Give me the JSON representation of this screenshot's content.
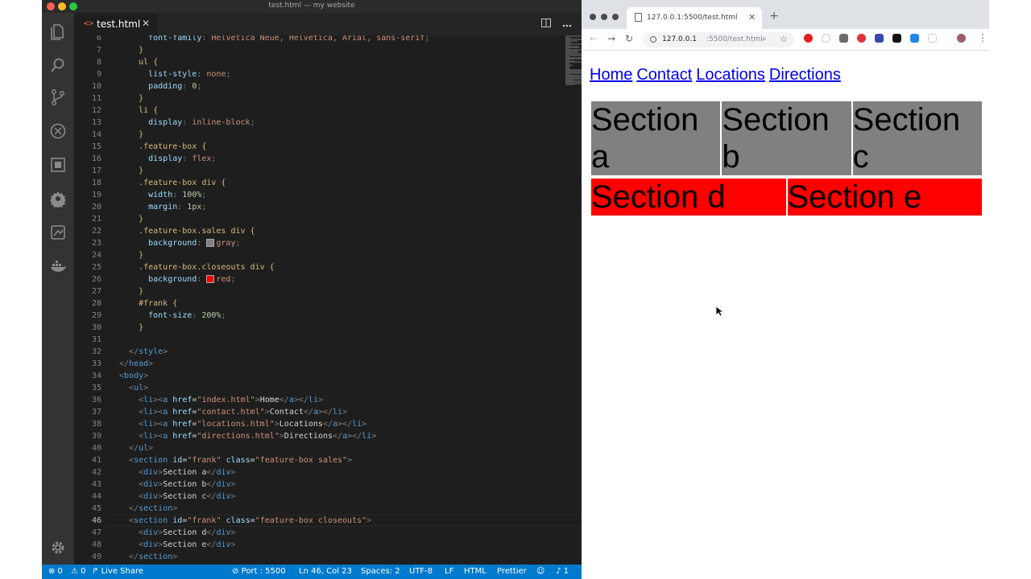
{
  "vscode": {
    "window_title": "test.html — my website",
    "tab": {
      "name": "test.html",
      "icon": "<>",
      "close": "✕"
    },
    "lines": [
      {
        "n": "6",
        "parts": [
          [
            "      ",
            "t"
          ],
          [
            "font-family",
            "prop"
          ],
          [
            ": ",
            "pun"
          ],
          [
            "Helvetica Neue, Helvetica, Arial, sans-serif",
            "val"
          ],
          [
            ";",
            "pun"
          ]
        ]
      },
      {
        "n": "7",
        "parts": [
          [
            "    }",
            "sel"
          ]
        ]
      },
      {
        "n": "8",
        "parts": [
          [
            "    ul {",
            "sel"
          ]
        ]
      },
      {
        "n": "9",
        "parts": [
          [
            "      ",
            "t"
          ],
          [
            "list-style",
            "prop"
          ],
          [
            ": ",
            "pun"
          ],
          [
            "none",
            "val"
          ],
          [
            ";",
            "pun"
          ]
        ]
      },
      {
        "n": "10",
        "parts": [
          [
            "      ",
            "t"
          ],
          [
            "padding",
            "prop"
          ],
          [
            ": ",
            "pun"
          ],
          [
            "0",
            "num"
          ],
          [
            ";",
            "pun"
          ]
        ]
      },
      {
        "n": "11",
        "parts": [
          [
            "    }",
            "sel"
          ]
        ]
      },
      {
        "n": "12",
        "parts": [
          [
            "    li {",
            "sel"
          ]
        ]
      },
      {
        "n": "13",
        "parts": [
          [
            "      ",
            "t"
          ],
          [
            "display",
            "prop"
          ],
          [
            ": ",
            "pun"
          ],
          [
            "inline-block",
            "val"
          ],
          [
            ";",
            "pun"
          ]
        ]
      },
      {
        "n": "14",
        "parts": [
          [
            "    }",
            "sel"
          ]
        ]
      },
      {
        "n": "15",
        "parts": [
          [
            "    .feature-box {",
            "sel"
          ]
        ]
      },
      {
        "n": "16",
        "parts": [
          [
            "      ",
            "t"
          ],
          [
            "display",
            "prop"
          ],
          [
            ": ",
            "pun"
          ],
          [
            "flex",
            "val"
          ],
          [
            ";",
            "pun"
          ]
        ]
      },
      {
        "n": "17",
        "parts": [
          [
            "    }",
            "sel"
          ]
        ]
      },
      {
        "n": "18",
        "parts": [
          [
            "    .feature-box div {",
            "sel"
          ]
        ]
      },
      {
        "n": "19",
        "parts": [
          [
            "      ",
            "t"
          ],
          [
            "width",
            "prop"
          ],
          [
            ": ",
            "pun"
          ],
          [
            "100%",
            "num"
          ],
          [
            ";",
            "pun"
          ]
        ]
      },
      {
        "n": "20",
        "parts": [
          [
            "      ",
            "t"
          ],
          [
            "margin",
            "prop"
          ],
          [
            ": ",
            "pun"
          ],
          [
            "1px",
            "num"
          ],
          [
            ";",
            "pun"
          ]
        ]
      },
      {
        "n": "21",
        "parts": [
          [
            "    }",
            "sel"
          ]
        ]
      },
      {
        "n": "22",
        "parts": [
          [
            "    .feature-box.sales div {",
            "sel"
          ]
        ]
      },
      {
        "n": "23",
        "parts": [
          [
            "      ",
            "t"
          ],
          [
            "background",
            "prop"
          ],
          [
            ": ",
            "pun"
          ],
          [
            "#808080",
            "swatch"
          ],
          [
            "gray",
            "val"
          ],
          [
            ";",
            "pun"
          ]
        ]
      },
      {
        "n": "24",
        "parts": [
          [
            "    }",
            "sel"
          ]
        ]
      },
      {
        "n": "25",
        "parts": [
          [
            "    .feature-box.closeouts div {",
            "sel"
          ]
        ]
      },
      {
        "n": "26",
        "parts": [
          [
            "      ",
            "t"
          ],
          [
            "background",
            "prop"
          ],
          [
            ": ",
            "pun"
          ],
          [
            "#ff0000",
            "swatch"
          ],
          [
            "red",
            "val"
          ],
          [
            ";",
            "pun"
          ]
        ]
      },
      {
        "n": "27",
        "parts": [
          [
            "    }",
            "sel"
          ]
        ]
      },
      {
        "n": "28",
        "parts": [
          [
            "    #frank {",
            "sel"
          ]
        ]
      },
      {
        "n": "29",
        "parts": [
          [
            "      ",
            "t"
          ],
          [
            "font-size",
            "prop"
          ],
          [
            ": ",
            "pun"
          ],
          [
            "200%",
            "num"
          ],
          [
            ";",
            "pun"
          ]
        ]
      },
      {
        "n": "30",
        "parts": [
          [
            "    }",
            "sel"
          ]
        ]
      },
      {
        "n": "31",
        "parts": [
          [
            "",
            "t"
          ]
        ]
      },
      {
        "n": "32",
        "parts": [
          [
            "  ",
            "t"
          ],
          [
            "</",
            "pun"
          ],
          [
            "style",
            "tag"
          ],
          [
            ">",
            "pun"
          ]
        ]
      },
      {
        "n": "33",
        "parts": [
          [
            "",
            "t"
          ],
          [
            "</",
            "pun"
          ],
          [
            "head",
            "tag"
          ],
          [
            ">",
            "pun"
          ]
        ]
      },
      {
        "n": "34",
        "parts": [
          [
            "",
            "t"
          ],
          [
            "<",
            "pun"
          ],
          [
            "body",
            "tag"
          ],
          [
            ">",
            "pun"
          ]
        ]
      },
      {
        "n": "35",
        "parts": [
          [
            "  ",
            "t"
          ],
          [
            "<",
            "pun"
          ],
          [
            "ul",
            "tag"
          ],
          [
            ">",
            "pun"
          ]
        ]
      },
      {
        "n": "36",
        "parts": [
          [
            "    ",
            "t"
          ],
          [
            "<",
            "pun"
          ],
          [
            "li",
            "tag"
          ],
          [
            "><",
            "pun"
          ],
          [
            "a",
            "tag"
          ],
          [
            " ",
            "t"
          ],
          [
            "href",
            "attr"
          ],
          [
            "=",
            "t"
          ],
          [
            "\"index.html\"",
            "str"
          ],
          [
            ">",
            "pun"
          ],
          [
            "Home",
            "t"
          ],
          [
            "</",
            "pun"
          ],
          [
            "a",
            "tag"
          ],
          [
            "></",
            "pun"
          ],
          [
            "li",
            "tag"
          ],
          [
            ">",
            "pun"
          ]
        ]
      },
      {
        "n": "37",
        "parts": [
          [
            "    ",
            "t"
          ],
          [
            "<",
            "pun"
          ],
          [
            "li",
            "tag"
          ],
          [
            "><",
            "pun"
          ],
          [
            "a",
            "tag"
          ],
          [
            " ",
            "t"
          ],
          [
            "href",
            "attr"
          ],
          [
            "=",
            "t"
          ],
          [
            "\"contact.html\"",
            "str"
          ],
          [
            ">",
            "pun"
          ],
          [
            "Contact",
            "t"
          ],
          [
            "</",
            "pun"
          ],
          [
            "a",
            "tag"
          ],
          [
            "></",
            "pun"
          ],
          [
            "li",
            "tag"
          ],
          [
            ">",
            "pun"
          ]
        ]
      },
      {
        "n": "38",
        "parts": [
          [
            "    ",
            "t"
          ],
          [
            "<",
            "pun"
          ],
          [
            "li",
            "tag"
          ],
          [
            "><",
            "pun"
          ],
          [
            "a",
            "tag"
          ],
          [
            " ",
            "t"
          ],
          [
            "href",
            "attr"
          ],
          [
            "=",
            "t"
          ],
          [
            "\"locations.html\"",
            "str"
          ],
          [
            ">",
            "pun"
          ],
          [
            "Locations",
            "t"
          ],
          [
            "</",
            "pun"
          ],
          [
            "a",
            "tag"
          ],
          [
            "></",
            "pun"
          ],
          [
            "li",
            "tag"
          ],
          [
            ">",
            "pun"
          ]
        ]
      },
      {
        "n": "39",
        "parts": [
          [
            "    ",
            "t"
          ],
          [
            "<",
            "pun"
          ],
          [
            "li",
            "tag"
          ],
          [
            "><",
            "pun"
          ],
          [
            "a",
            "tag"
          ],
          [
            " ",
            "t"
          ],
          [
            "href",
            "attr"
          ],
          [
            "=",
            "t"
          ],
          [
            "\"directions.html\"",
            "str"
          ],
          [
            ">",
            "pun"
          ],
          [
            "Directions",
            "t"
          ],
          [
            "</",
            "pun"
          ],
          [
            "a",
            "tag"
          ],
          [
            "></",
            "pun"
          ],
          [
            "li",
            "tag"
          ],
          [
            ">",
            "pun"
          ]
        ]
      },
      {
        "n": "40",
        "parts": [
          [
            "  ",
            "t"
          ],
          [
            "</",
            "pun"
          ],
          [
            "ul",
            "tag"
          ],
          [
            ">",
            "pun"
          ]
        ]
      },
      {
        "n": "41",
        "parts": [
          [
            "  ",
            "t"
          ],
          [
            "<",
            "pun"
          ],
          [
            "section",
            "tag"
          ],
          [
            " ",
            "t"
          ],
          [
            "id",
            "attr"
          ],
          [
            "=",
            "t"
          ],
          [
            "\"frank\"",
            "str"
          ],
          [
            " ",
            "t"
          ],
          [
            "class",
            "attr"
          ],
          [
            "=",
            "t"
          ],
          [
            "\"feature-box sales\"",
            "str"
          ],
          [
            ">",
            "pun"
          ]
        ]
      },
      {
        "n": "42",
        "parts": [
          [
            "    ",
            "t"
          ],
          [
            "<",
            "pun"
          ],
          [
            "div",
            "tag"
          ],
          [
            ">",
            "pun"
          ],
          [
            "Section a",
            "t"
          ],
          [
            "</",
            "pun"
          ],
          [
            "div",
            "tag"
          ],
          [
            ">",
            "pun"
          ]
        ]
      },
      {
        "n": "43",
        "parts": [
          [
            "    ",
            "t"
          ],
          [
            "<",
            "pun"
          ],
          [
            "div",
            "tag"
          ],
          [
            ">",
            "pun"
          ],
          [
            "Section b",
            "t"
          ],
          [
            "</",
            "pun"
          ],
          [
            "div",
            "tag"
          ],
          [
            ">",
            "pun"
          ]
        ]
      },
      {
        "n": "44",
        "parts": [
          [
            "    ",
            "t"
          ],
          [
            "<",
            "pun"
          ],
          [
            "div",
            "tag"
          ],
          [
            ">",
            "pun"
          ],
          [
            "Section c",
            "t"
          ],
          [
            "</",
            "pun"
          ],
          [
            "div",
            "tag"
          ],
          [
            ">",
            "pun"
          ]
        ]
      },
      {
        "n": "45",
        "parts": [
          [
            "  ",
            "t"
          ],
          [
            "</",
            "pun"
          ],
          [
            "section",
            "tag"
          ],
          [
            ">",
            "pun"
          ]
        ]
      },
      {
        "n": "46",
        "current": true,
        "parts": [
          [
            "  ",
            "t"
          ],
          [
            "<",
            "pun"
          ],
          [
            "section",
            "tag"
          ],
          [
            " ",
            "t"
          ],
          [
            "id",
            "attr"
          ],
          [
            "=",
            "t"
          ],
          [
            "\"frank\"",
            "str"
          ],
          [
            " ",
            "t"
          ],
          [
            "class",
            "attr"
          ],
          [
            "=",
            "t"
          ],
          [
            "\"feature-box closeouts\"",
            "str"
          ],
          [
            ">",
            "pun"
          ]
        ]
      },
      {
        "n": "47",
        "parts": [
          [
            "    ",
            "t"
          ],
          [
            "<",
            "pun"
          ],
          [
            "div",
            "tag"
          ],
          [
            ">",
            "pun"
          ],
          [
            "Section d",
            "t"
          ],
          [
            "</",
            "pun"
          ],
          [
            "div",
            "tag"
          ],
          [
            ">",
            "pun"
          ]
        ]
      },
      {
        "n": "48",
        "parts": [
          [
            "    ",
            "t"
          ],
          [
            "<",
            "pun"
          ],
          [
            "div",
            "tag"
          ],
          [
            ">",
            "pun"
          ],
          [
            "Section e",
            "t"
          ],
          [
            "</",
            "pun"
          ],
          [
            "div",
            "tag"
          ],
          [
            ">",
            "pun"
          ]
        ]
      },
      {
        "n": "49",
        "parts": [
          [
            "  ",
            "t"
          ],
          [
            "</",
            "pun"
          ],
          [
            "section",
            "tag"
          ],
          [
            ">",
            "pun"
          ]
        ]
      }
    ],
    "status": {
      "errors": "⊗ 0",
      "warnings": "⚠ 0",
      "live_share": "Live Share",
      "port": "Port : 5500",
      "cursor_pos": "Ln 46, Col 23",
      "spaces": "Spaces: 2",
      "encoding": "UTF-8",
      "eol": "LF",
      "language": "HTML",
      "formatter": "Prettier",
      "notifications": "1"
    }
  },
  "chrome": {
    "tab_title": "127.0.0.1:5500/test.html",
    "url_host": "127.0.0.1",
    "url_path": ":5500/test.html",
    "page": {
      "nav_links": [
        "Home",
        "Contact",
        "Locations",
        "Directions"
      ],
      "sales_sections": [
        "Section a",
        "Section b",
        "Section c"
      ],
      "closeouts_sections": [
        "Section d",
        "Section e"
      ]
    }
  },
  "colors": {
    "gray_box": "#808080",
    "red_box": "#ff0000",
    "vscode_status": "#007acc"
  }
}
